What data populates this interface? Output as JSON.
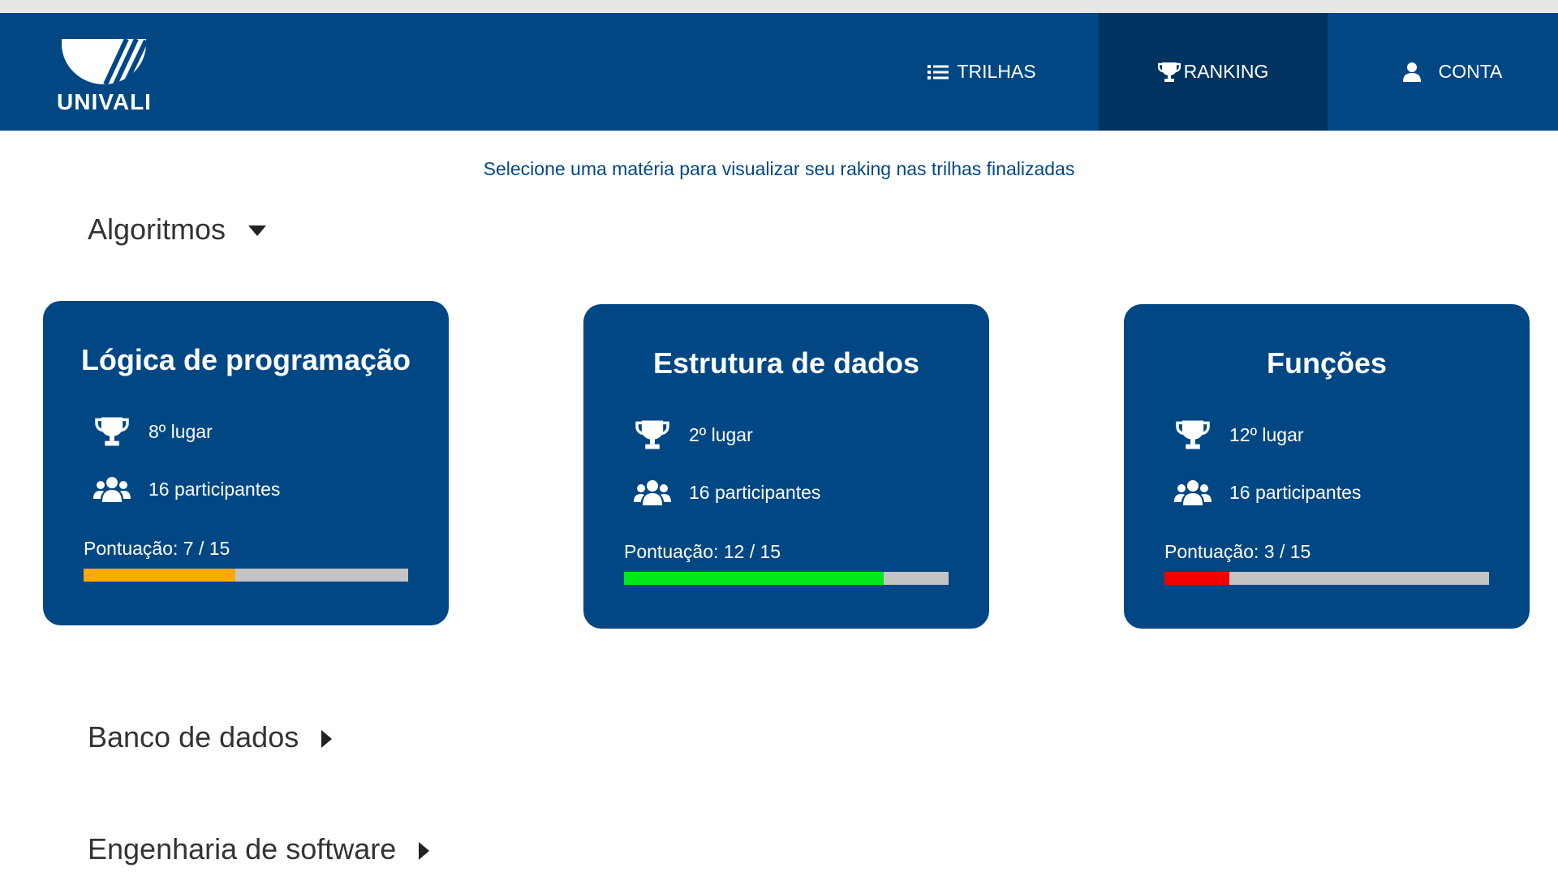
{
  "header": {
    "logo_text": "UNIVALI",
    "nav": {
      "trilhas": "TRILHAS",
      "ranking": "RANKING",
      "conta": "CONTA"
    }
  },
  "subtitle": "Selecione uma matéria para visualizar seu raking nas trilhas finalizadas",
  "sections": [
    {
      "label": "Algoritmos",
      "expanded": true,
      "icon": "caret-down-icon"
    },
    {
      "label": "Banco de dados",
      "expanded": false,
      "icon": "caret-right-icon"
    },
    {
      "label": "Engenharia de software",
      "expanded": false,
      "icon": "caret-right-icon"
    }
  ],
  "cards": [
    {
      "title": "Lógica de programação",
      "place": "8º lugar",
      "participants": "16 participantes",
      "score_label": "Pontuação: 7 / 15",
      "score": 7,
      "max": 15,
      "bar_color": "#ffa800"
    },
    {
      "title": "Estrutura de dados",
      "place": "2º lugar",
      "participants": "16 participantes",
      "score_label": "Pontuação: 12 / 15",
      "score": 12,
      "max": 15,
      "bar_color": "#00e81a"
    },
    {
      "title": "Funções",
      "place": "12º lugar",
      "participants": "16 participantes",
      "score_label": "Pontuação: 3 / 15",
      "score": 3,
      "max": 15,
      "bar_color": "#f20000"
    }
  ],
  "colors": {
    "primary": "#004784",
    "primary_dark": "#00335f",
    "bar_bg": "#c4c4c4"
  }
}
